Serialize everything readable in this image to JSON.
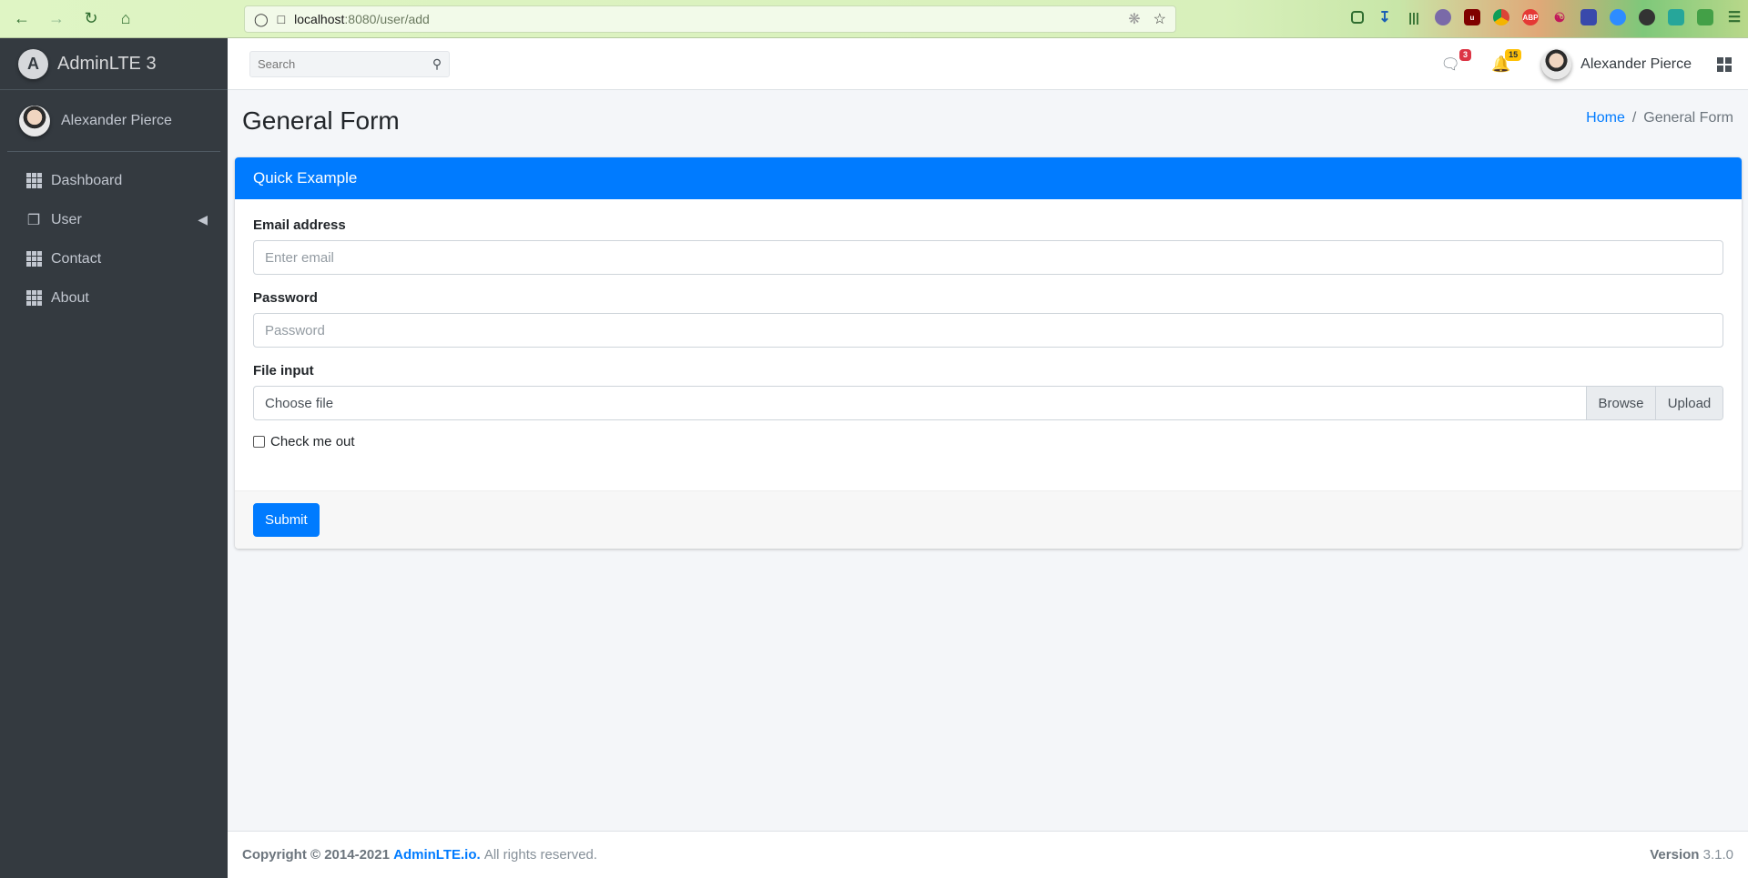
{
  "browser": {
    "url_host": "localhost",
    "url_path": ":8080/user/add"
  },
  "sidebar": {
    "brand": "AdminLTE 3",
    "brand_logo_letter": "A",
    "user_name": "Alexander Pierce",
    "items": [
      {
        "label": "Dashboard",
        "icon": "grid-icon"
      },
      {
        "label": "User",
        "icon": "copy-icon"
      },
      {
        "label": "Contact",
        "icon": "grid-icon"
      },
      {
        "label": "About",
        "icon": "grid-icon"
      }
    ]
  },
  "topbar": {
    "search_placeholder": "Search",
    "messages_count": "3",
    "notifications_count": "15",
    "user_name": "Alexander Pierce",
    "colors": {
      "messages_badge": "#dc3545",
      "notifications_badge": "#ffc107"
    }
  },
  "header": {
    "title": "General Form",
    "breadcrumb_home": "Home",
    "breadcrumb_current": "General Form",
    "separator": "/"
  },
  "card": {
    "title": "Quick Example",
    "email_label": "Email address",
    "email_placeholder": "Enter email",
    "password_label": "Password",
    "password_placeholder": "Password",
    "file_label": "File input",
    "file_choose": "Choose file",
    "file_browse": "Browse",
    "file_upload": "Upload",
    "checkbox_label": "Check me out",
    "submit": "Submit",
    "accent": "#007bff"
  },
  "footer": {
    "copyright": "Copyright © 2014-2021",
    "brand_link": "AdminLTE.io.",
    "rights": "All rights reserved.",
    "version_label": "Version",
    "version": "3.1.0"
  }
}
